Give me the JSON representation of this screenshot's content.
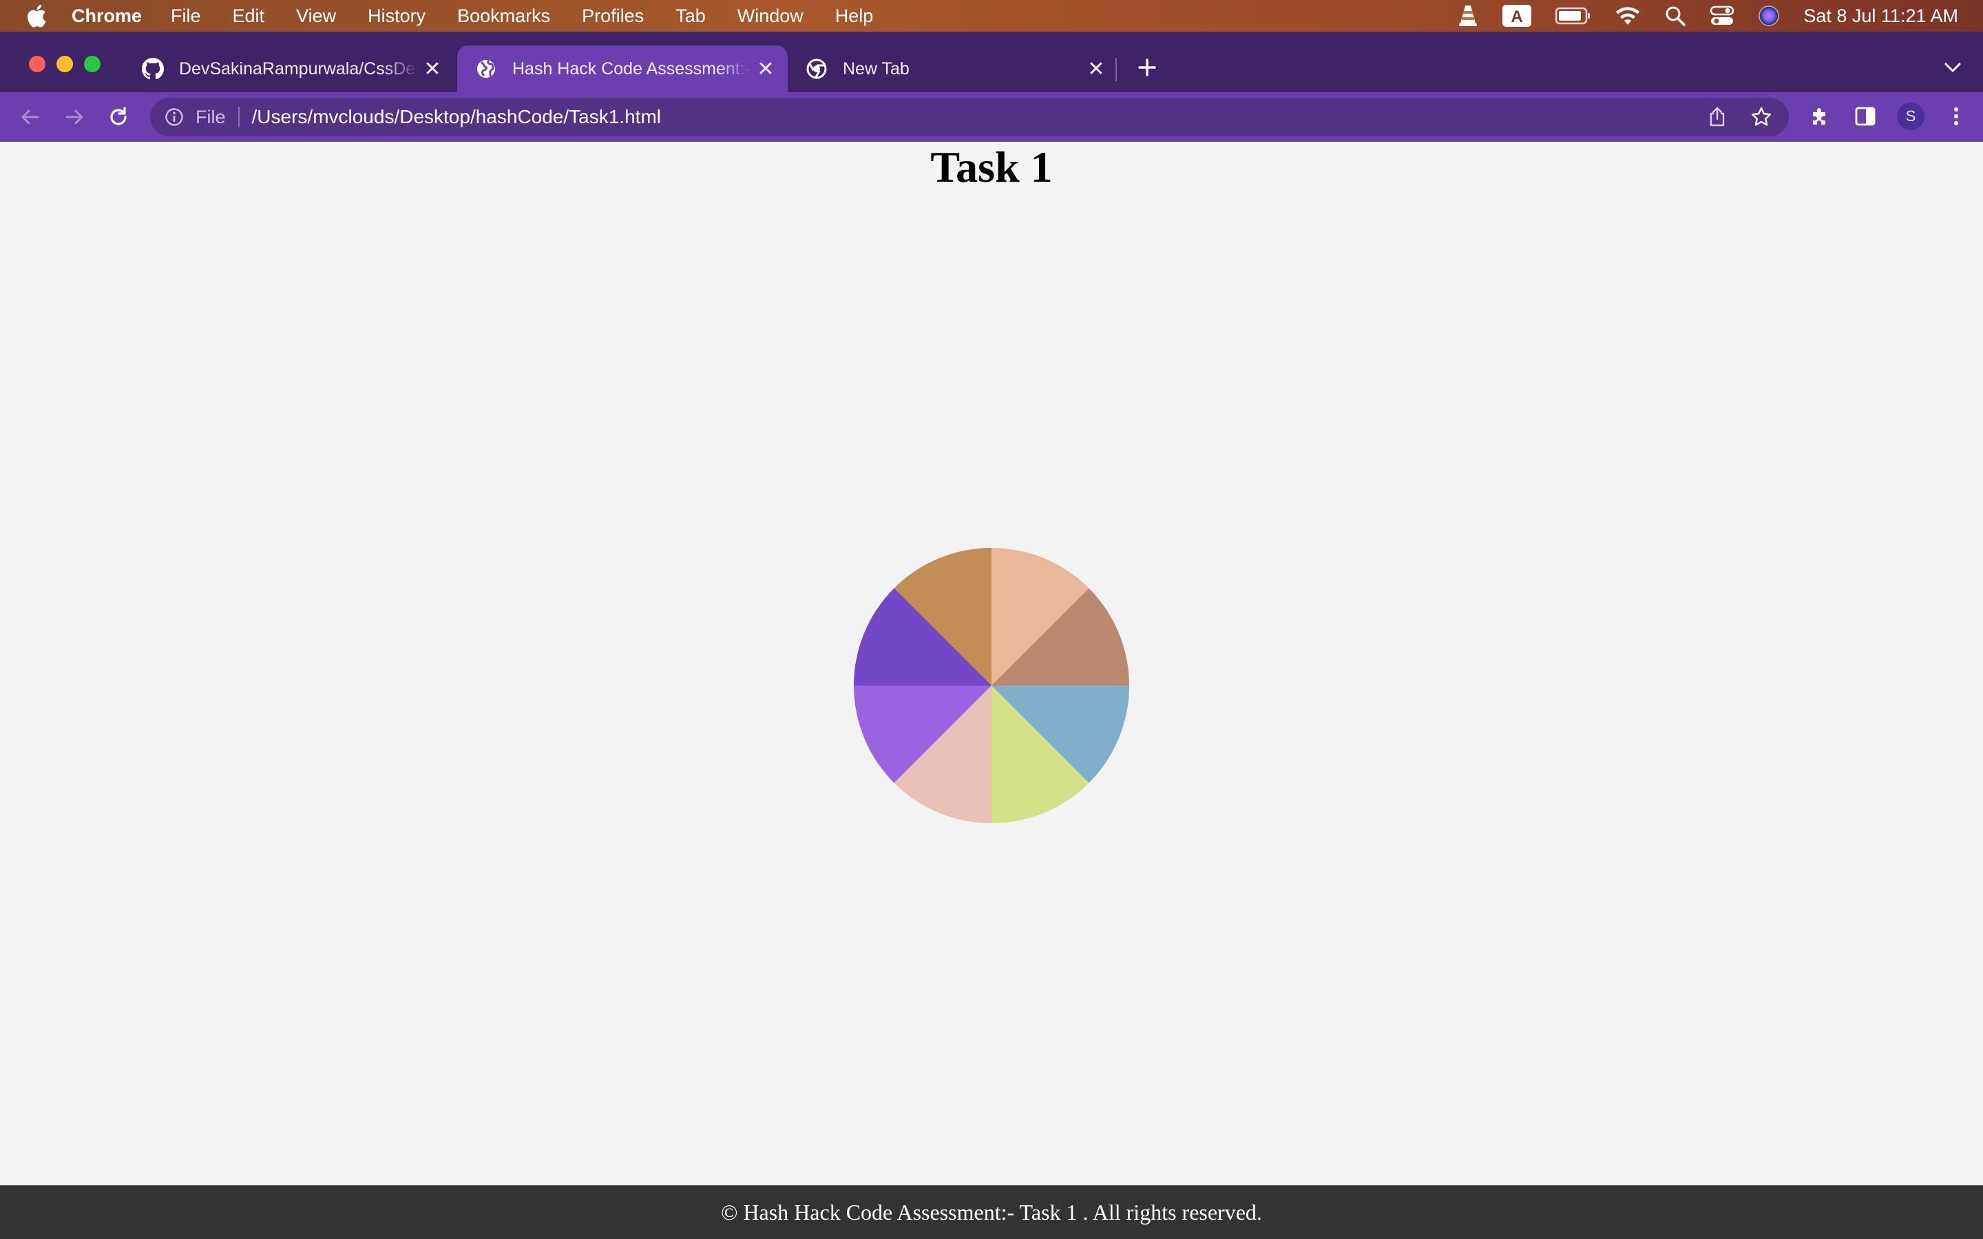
{
  "menubar": {
    "app_name": "Chrome",
    "items": [
      "File",
      "Edit",
      "View",
      "History",
      "Bookmarks",
      "Profiles",
      "Tab",
      "Window",
      "Help"
    ],
    "input_source": "A",
    "clock": "Sat 8 Jul  11:21 AM"
  },
  "browser": {
    "tabs": [
      {
        "title": "DevSakinaRampurwala/CssDes",
        "icon": "github-icon",
        "active": false
      },
      {
        "title": "Hash Hack Code Assessment:-",
        "icon": "globe-icon",
        "active": true
      },
      {
        "title": "New Tab",
        "icon": "chrome-icon",
        "active": false
      }
    ],
    "address": {
      "scheme": "File",
      "url": "/Users/mvclouds/Desktop/hashCode/Task1.html"
    },
    "profile_initial": "S",
    "colors": {
      "tabstrip": "#3e2466",
      "toolbar": "#6b3fb0",
      "omnibox": "#533285"
    }
  },
  "page": {
    "title": "Task 1",
    "footer": "© Hash Hack Code Assessment:- Task 1 . All rights reserved.",
    "pinwheel_colors": [
      "#2e2548",
      "#e8a04a",
      "#e8b8a8",
      "#a87050",
      "#6ab8e8",
      "#eeea60",
      "#e8b0c8",
      "#7a3ee8"
    ]
  }
}
